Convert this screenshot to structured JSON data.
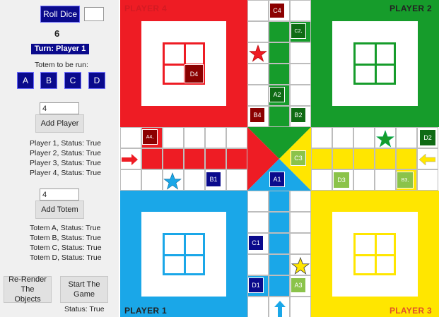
{
  "controls": {
    "roll_dice": "Roll Dice",
    "dice_value": "6",
    "turn": "Turn: Player 1",
    "totem_prompt": "Totem to be run:",
    "totem_buttons": [
      "A",
      "B",
      "C",
      "D"
    ],
    "player_input": "4",
    "add_player": "Add Player",
    "player_status": [
      "Player 1, Status: True",
      "Player 2, Status: True",
      "Player 3, Status: True",
      "Player 4, Status: True"
    ],
    "totem_input": "4",
    "add_totem": "Add Totem",
    "totem_status": [
      "Totem A, Status: True",
      "Totem B, Status: True",
      "Totem C, Status: True",
      "Totem D, Status: True"
    ],
    "rerender": "Re-Render The Objects",
    "start_game": "Start The Game",
    "status": "Status: True"
  },
  "board": {
    "labels": {
      "player4": "PLAYER 4",
      "player2": "PLAYER 2",
      "player1": "PLAYER 1",
      "player3": "PLAYER 3"
    },
    "colors": {
      "red": "#ee1c24",
      "green": "#169c2b",
      "yellow": "#ffe600",
      "blue": "#1aa7e8",
      "dark_red": "#8b0000",
      "dark_green": "#0f6b14",
      "light_green": "#8bc34a",
      "navy": "#0a0a8c"
    },
    "tokens": {
      "C4": "C4",
      "C2": "C2,",
      "D4": "D4",
      "A2": "A2",
      "B4": "B4",
      "B2": "B2",
      "A4": "A4,",
      "D2": "D2",
      "C3": "C3",
      "B1": "B1",
      "A1": "A1",
      "D3": "D3",
      "B3": "B3,",
      "C1": "C1",
      "D1": "D1",
      "A3": "A3"
    }
  }
}
